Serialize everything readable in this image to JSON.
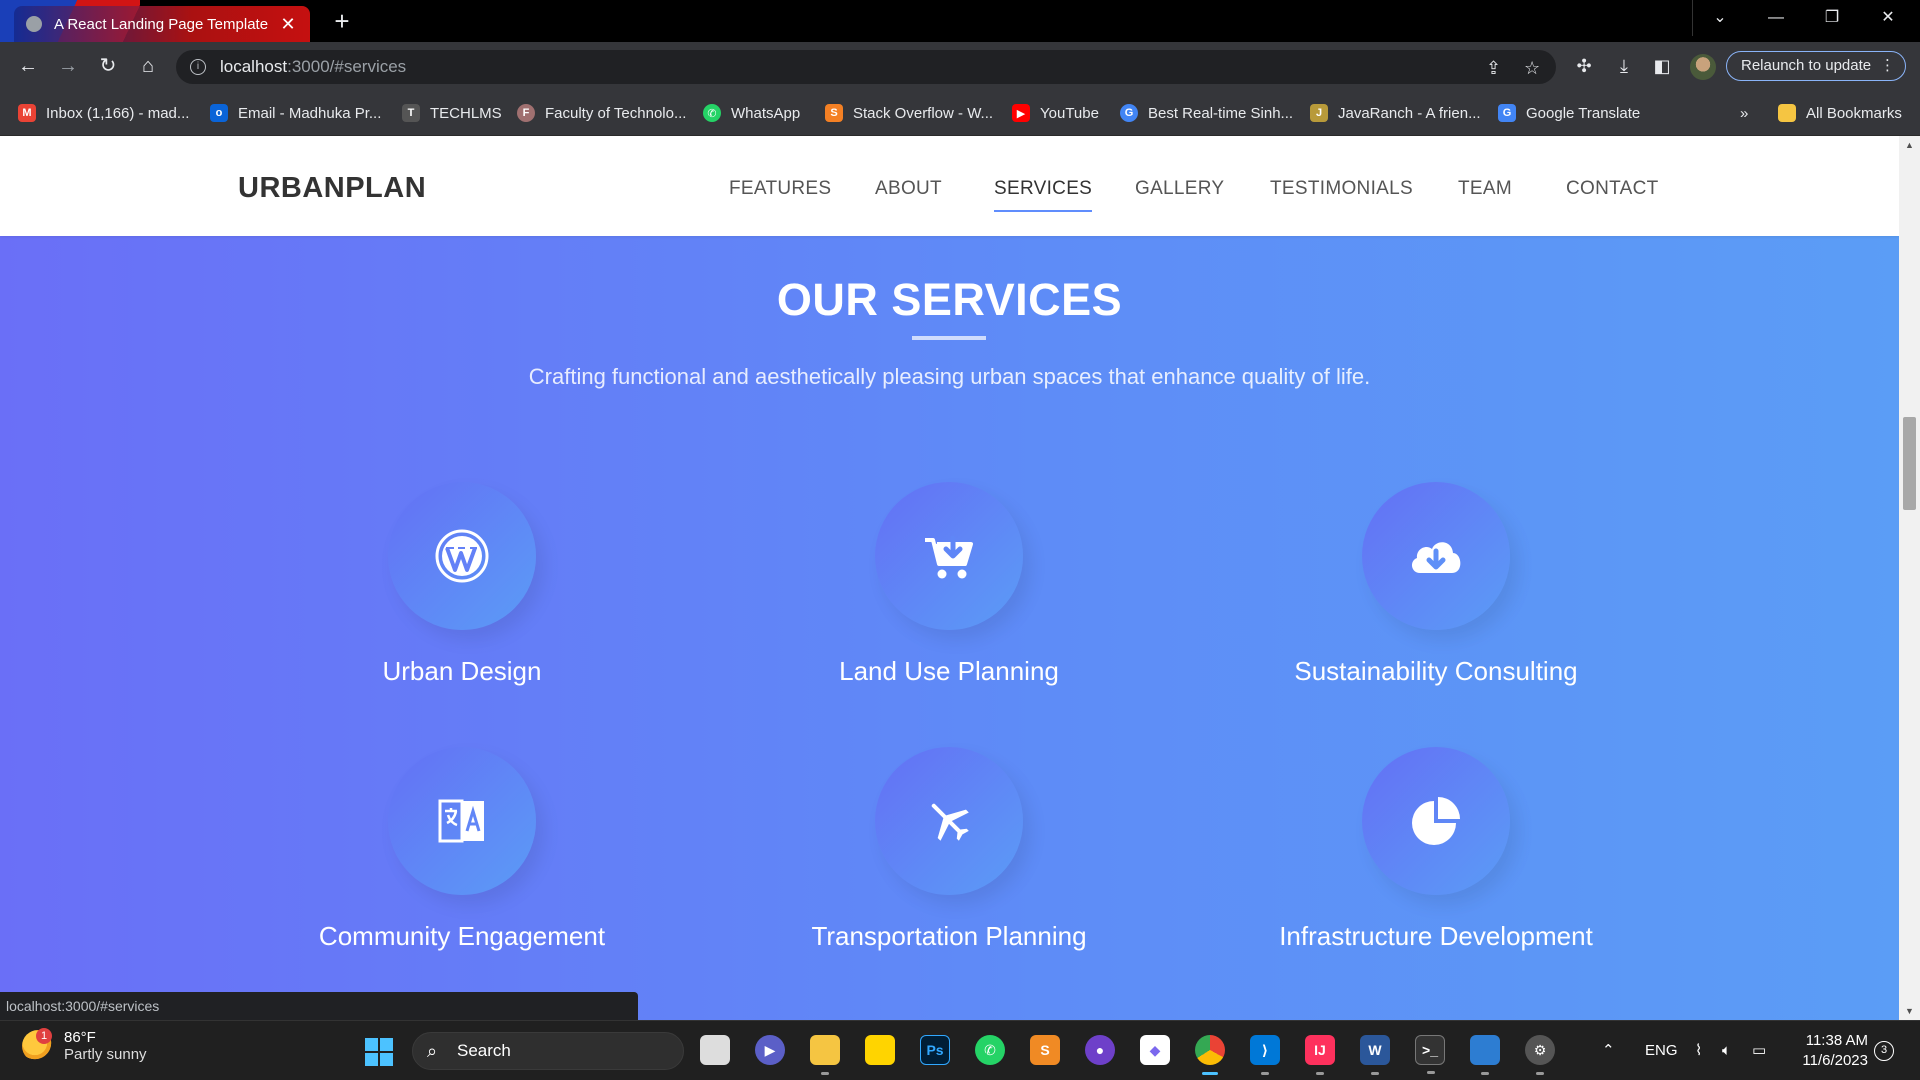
{
  "browser": {
    "tab_title": "A React Landing Page Template",
    "url_host": "localhost",
    "url_rest": ":3000/#services",
    "relaunch_label": "Relaunch to update",
    "status_url": "localhost:3000/#services"
  },
  "bookmarks": [
    {
      "label": "Inbox (1,166) - mad...",
      "icon": "gmail-icon",
      "color": "#ea4335"
    },
    {
      "label": "Email - Madhuka Pr...",
      "icon": "outlook-icon",
      "color": "#0a64d8"
    },
    {
      "label": "TECHLMS",
      "icon": "techlms-icon",
      "color": "#555555"
    },
    {
      "label": "Faculty of Technolo...",
      "icon": "faculty-icon",
      "color": "#a07070"
    },
    {
      "label": "WhatsApp",
      "icon": "whatsapp-icon",
      "color": "#25d366"
    },
    {
      "label": "Stack Overflow - W...",
      "icon": "stackoverflow-icon",
      "color": "#f48024"
    },
    {
      "label": "YouTube",
      "icon": "youtube-icon",
      "color": "#ff0000"
    },
    {
      "label": "Best Real-time Sinh...",
      "icon": "google-icon",
      "color": "#4285f4"
    },
    {
      "label": "JavaRanch - A frien...",
      "icon": "javaranch-icon",
      "color": "#b89a3a"
    },
    {
      "label": "Google Translate",
      "icon": "translate-icon",
      "color": "#4285f4"
    }
  ],
  "all_bookmarks_label": "All Bookmarks",
  "site": {
    "logo": "URBANPLAN",
    "nav": [
      "FEATURES",
      "ABOUT",
      "SERVICES",
      "GALLERY",
      "TESTIMONIALS",
      "TEAM",
      "CONTACT"
    ],
    "active_nav": "SERVICES",
    "section_title": "OUR SERVICES",
    "section_subtitle": "Crafting functional and aesthetically pleasing urban spaces that enhance quality of life.",
    "services": [
      {
        "name": "Urban Design",
        "icon": "wordpress-icon"
      },
      {
        "name": "Land Use Planning",
        "icon": "cart-arrow-down-icon"
      },
      {
        "name": "Sustainability Consulting",
        "icon": "cloud-download-icon"
      },
      {
        "name": "Community Engagement",
        "icon": "language-icon"
      },
      {
        "name": "Transportation Planning",
        "icon": "plane-icon"
      },
      {
        "name": "Infrastructure Development",
        "icon": "pie-chart-icon"
      }
    ]
  },
  "taskbar": {
    "weather_temp": "86°F",
    "weather_desc": "Partly sunny",
    "weather_badge": "1",
    "search_label": "Search",
    "language": "ENG",
    "time": "11:38 AM",
    "date": "11/6/2023",
    "notifications": "3"
  },
  "colors": {
    "gradient_start": "#6a6ff7",
    "gradient_end": "#5b9df6",
    "nav_underline": "#608dfd"
  }
}
